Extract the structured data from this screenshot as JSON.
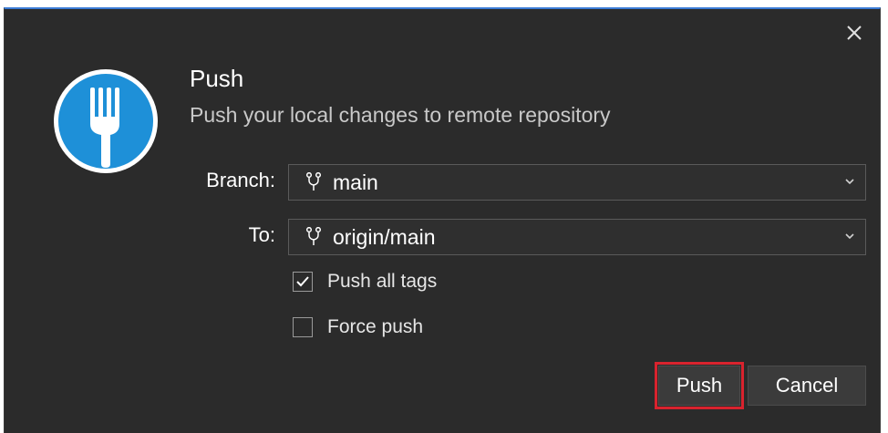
{
  "dialog": {
    "title": "Push",
    "subtitle": "Push your local changes to remote repository",
    "close_icon": "close-icon",
    "logo_icon": "fork-icon",
    "accent_color": "#3a7bd5",
    "logo_color": "#1e90d8"
  },
  "form": {
    "branch_label": "Branch:",
    "branch_value": "main",
    "to_label": "To:",
    "to_value": "origin/main",
    "branch_icon": "git-branch-icon",
    "dropdown_icon": "chevron-down-icon"
  },
  "options": {
    "push_all_tags": {
      "label": "Push all tags",
      "checked": true
    },
    "force_push": {
      "label": "Force push",
      "checked": false
    }
  },
  "buttons": {
    "push_label": "Push",
    "cancel_label": "Cancel",
    "highlight_color": "#d9232e"
  }
}
